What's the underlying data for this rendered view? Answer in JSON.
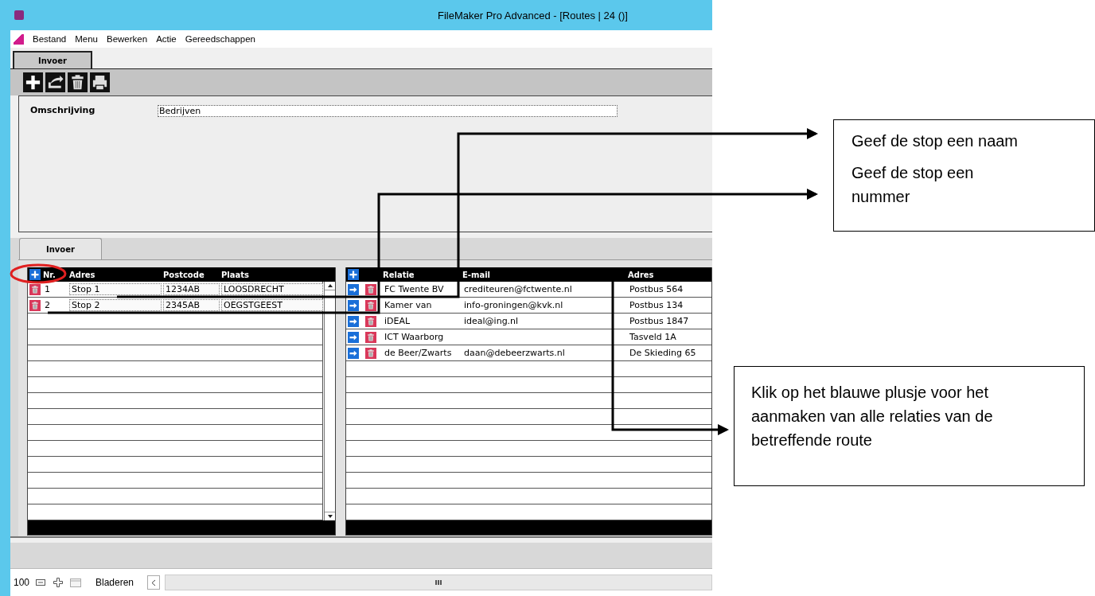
{
  "window": {
    "title": "FileMaker Pro Advanced - [Routes | 24 ()]"
  },
  "menu": [
    "Bestand",
    "Menu",
    "Bewerken",
    "Actie",
    "Gereedschappen"
  ],
  "top_tab": {
    "label": "Invoer"
  },
  "form": {
    "label": "Omschrijving",
    "value": "Bedrijven"
  },
  "lower_tab": {
    "label": "Invoer"
  },
  "stops": {
    "columns": [
      "Nr.",
      "Adres",
      "Postcode",
      "Plaats"
    ],
    "rows": [
      {
        "nr": "1",
        "adres": "Stop 1",
        "postcode": "1234AB",
        "plaats": "LOOSDRECHT"
      },
      {
        "nr": "2",
        "adres": "Stop 2",
        "postcode": "2345AB",
        "plaats": "OEGSTGEEST"
      }
    ]
  },
  "relations": {
    "columns": [
      "Relatie",
      "E-mail",
      "Adres"
    ],
    "rows": [
      {
        "relatie": "FC Twente BV",
        "email": "crediteuren@fctwente.nl",
        "adres": "Postbus 564"
      },
      {
        "relatie": "Kamer van",
        "email": "info-groningen@kvk.nl",
        "adres": "Postbus 134"
      },
      {
        "relatie": "iDEAL",
        "email": "ideal@ing.nl",
        "adres": "Postbus 1847"
      },
      {
        "relatie": "ICT Waarborg",
        "email": "",
        "adres": "Tasveld 1A"
      },
      {
        "relatie": "de Beer/Zwarts",
        "email": "daan@debeerzwarts.nl",
        "adres": "De Skieding 65"
      }
    ]
  },
  "status_bar": {
    "zoom": "100",
    "mode": "Bladeren"
  },
  "callouts": [
    {
      "texts": [
        "Geef de stop een naam",
        "Geef de stop een nummer"
      ]
    },
    {
      "texts": [
        "Klik op het blauwe plusje voor het aanmaken van alle relaties van de betreffende route"
      ]
    }
  ]
}
